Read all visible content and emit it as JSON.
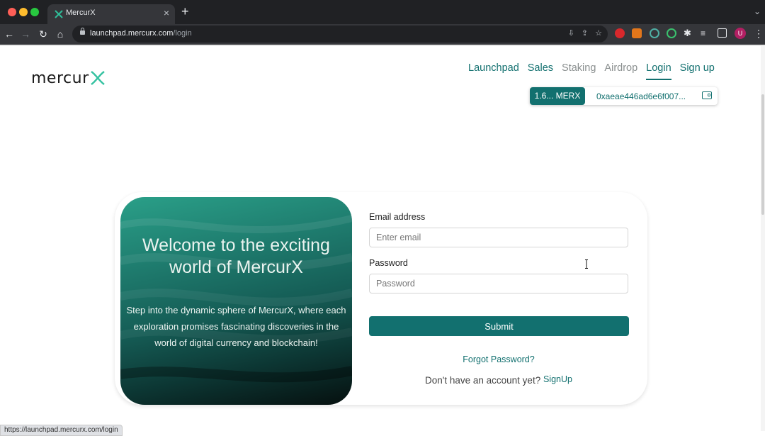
{
  "browser": {
    "tab_title": "MercurX",
    "tab_close": "×",
    "new_tab": "+",
    "url_host": "launchpad.mercurx.com",
    "url_path": "/login",
    "avatar_letter": "U",
    "status_url": "https://launchpad.mercurx.com/login"
  },
  "site": {
    "logo_text": "mercur",
    "nav": [
      {
        "label": "Launchpad"
      },
      {
        "label": "Sales"
      },
      {
        "label": "Staking"
      },
      {
        "label": "Airdrop"
      },
      {
        "label": "Login"
      },
      {
        "label": "Sign up"
      }
    ],
    "balance": "1.6... MERX",
    "wallet_address": "0xaeae446ad6e6f007..."
  },
  "hero": {
    "title": "Welcome to the exciting world of MercurX",
    "subtitle": "Step into the dynamic sphere of MercurX, where each exploration promises fascinating discoveries in the world of digital currency and blockchain!"
  },
  "form": {
    "email_label": "Email address",
    "email_placeholder": "Enter email",
    "email_value": "",
    "password_label": "Password",
    "password_placeholder": "Password",
    "password_value": "",
    "submit_label": "Submit",
    "forgot_label": "Forgot Password?",
    "no_account_text": "Don't have an account yet?",
    "signup_label": "SignUp"
  },
  "colors": {
    "brand": "#12706f",
    "chrome_dark": "#202124"
  }
}
